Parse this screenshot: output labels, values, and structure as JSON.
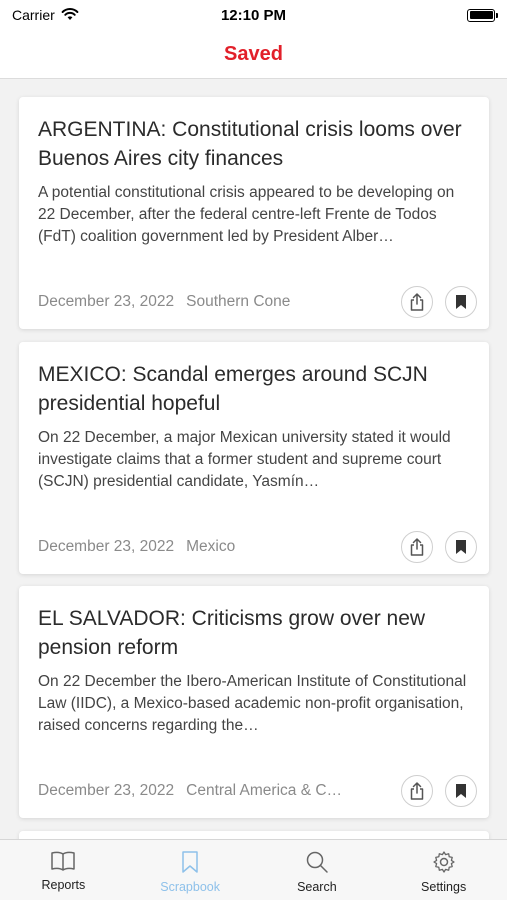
{
  "status_bar": {
    "carrier": "Carrier",
    "time": "12:10 PM"
  },
  "nav": {
    "title": "Saved"
  },
  "articles": [
    {
      "title": "ARGENTINA: Constitutional crisis looms over Buenos Aires city finances",
      "summary": "A potential constitutional crisis appeared to be developing on 22 December, after the federal centre-left Frente de Todos (FdT) coalition government led by President Alber…",
      "date": "December 23, 2022",
      "region": "Southern Cone"
    },
    {
      "title": "MEXICO: Scandal emerges around SCJN presidential hopeful",
      "summary": "On 22 December, a major Mexican university stated it would investigate claims that a former student and supreme court (SCJN) presidential candidate, Yasmín…",
      "date": "December 23, 2022",
      "region": "Mexico"
    },
    {
      "title": "EL SALVADOR: Criticisms grow over new pension reform",
      "summary": "On 22 December the Ibero-American Institute of Constitutional Law (IIDC), a Mexico-based academic non-profit organisation, raised concerns regarding the…",
      "date": "December 23, 2022",
      "region": "Central America & C…"
    }
  ],
  "tabs": [
    {
      "label": "Reports",
      "icon": "book-icon",
      "active": false
    },
    {
      "label": "Scrapbook",
      "icon": "bookmark-icon",
      "active": true
    },
    {
      "label": "Search",
      "icon": "search-icon",
      "active": false
    },
    {
      "label": "Settings",
      "icon": "gear-icon",
      "active": false
    }
  ],
  "colors": {
    "accent": "#e2202a",
    "tab_active": "#8ec1ea"
  }
}
